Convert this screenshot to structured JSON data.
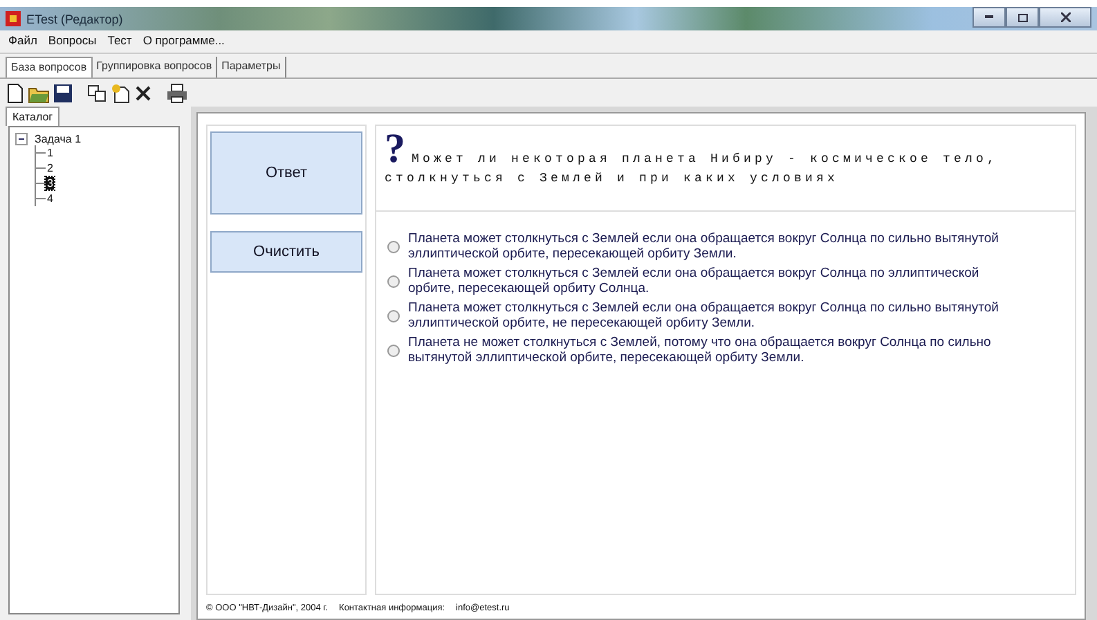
{
  "window": {
    "title": "ETest (Редактор)"
  },
  "menu": [
    "Файл",
    "Вопросы",
    "Тест",
    "О программе..."
  ],
  "tabs": [
    {
      "label": "База вопросов",
      "selected": true
    },
    {
      "label": "Группировка вопросов",
      "selected": false
    },
    {
      "label": "Параметры",
      "selected": false
    }
  ],
  "toolbar": [
    {
      "kind": "new"
    },
    {
      "kind": "open"
    },
    {
      "kind": "save"
    },
    {
      "kind": "sep"
    },
    {
      "kind": "copy"
    },
    {
      "kind": "paste"
    },
    {
      "kind": "delete"
    },
    {
      "kind": "sep"
    },
    {
      "kind": "print"
    }
  ],
  "sidebar": {
    "tab": "Каталог",
    "tree": [
      {
        "label": "Задача 1",
        "expanded": true,
        "selected": false,
        "children": [
          {
            "label": "1",
            "selected": false
          },
          {
            "label": "2",
            "selected": false
          },
          {
            "label": "3",
            "selected": true
          },
          {
            "label": "4",
            "selected": false
          }
        ]
      }
    ]
  },
  "buttons": [
    "Ответ",
    "Очистить"
  ],
  "question": {
    "mark": "?",
    "text": "Может ли некоторая планета Нибиру - космическое тело, столкнуться с Землей и при каких условиях"
  },
  "answers": [
    {
      "text": "Планета может столкнуться с Землей если она обращается вокруг Солнца по сильно вытянутой эллиптической орбите, пересекающей орбиту Земли.",
      "selected": false
    },
    {
      "text": "Планета может столкнуться с Землей если она обращается вокруг Солнца по эллиптической орбите, пересекающей орбиту Солнца.",
      "selected": false
    },
    {
      "text": "Планета может столкнуться с Землей если она обращается вокруг Солнца по сильно вытянутой эллиптической орбите, не пересекающей орбиту Земли.",
      "selected": false
    },
    {
      "text": "Планета не может столкнуться с Землей, потому что она обращается вокруг Солнца по сильно вытянутой эллиптической орбите, пересекающей орбиту Земли.",
      "selected": false
    }
  ],
  "footer": {
    "copyright": "© ООО \"НВТ-Дизайн\", 2004 г.",
    "contact_label": "Контактная информация:",
    "email": "info@etest.ru"
  }
}
